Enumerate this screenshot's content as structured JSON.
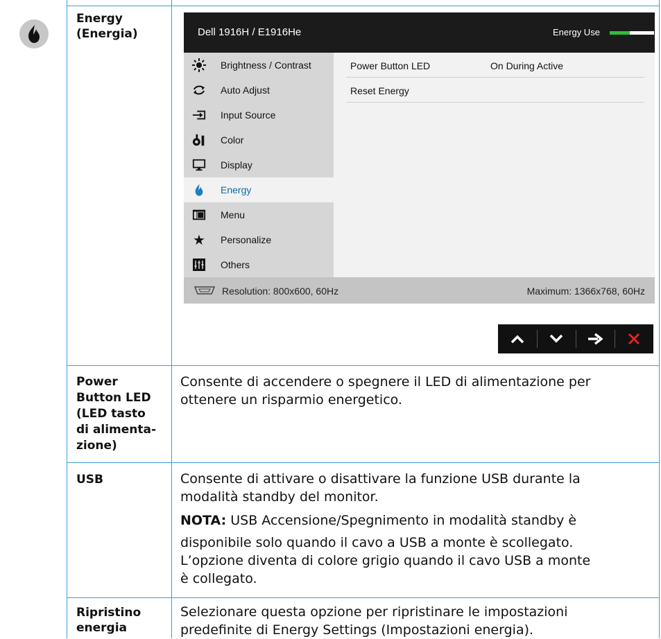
{
  "feature": {
    "title": "Energy (Energia)",
    "title_line1": "Energy",
    "title_line2": "(Energia)",
    "icon": "flame-icon"
  },
  "osd": {
    "model": "Dell 1916H / E1916He",
    "energy_use_label": "Energy Use",
    "energy_use_level_percent": 45,
    "menu": [
      {
        "label": "Brightness / Contrast",
        "icon": "brightness-icon"
      },
      {
        "label": "Auto Adjust",
        "icon": "auto-adjust-icon"
      },
      {
        "label": "Input Source",
        "icon": "input-source-icon"
      },
      {
        "label": "Color",
        "icon": "color-icon"
      },
      {
        "label": "Display",
        "icon": "display-icon"
      },
      {
        "label": "Energy",
        "icon": "flame-icon",
        "active": true
      },
      {
        "label": "Menu",
        "icon": "menu-icon"
      },
      {
        "label": "Personalize",
        "icon": "star-icon"
      },
      {
        "label": "Others",
        "icon": "others-icon"
      }
    ],
    "submenu": [
      {
        "label": "Power Button LED",
        "value": "On During Active"
      },
      {
        "label": "Reset Energy",
        "value": ""
      }
    ],
    "resolution": "Resolution: 800x600, 60Hz",
    "maximum": "Maximum: 1366x768, 60Hz",
    "nav_buttons": [
      "up-arrow-icon",
      "down-arrow-icon",
      "right-arrow-icon",
      "close-icon"
    ]
  },
  "rows": [
    {
      "label_lines": [
        "Power",
        "Button LED",
        "(LED tasto",
        "di alimenta-",
        "zione)"
      ],
      "desc_lines": [
        "Consente di accendere o spegnere il LED di alimentazione per",
        "ottenere un risparmio energetico."
      ]
    },
    {
      "label_lines": [
        "USB"
      ],
      "desc_lines": [
        "Consente di attivare o disattivare la funzione USB durante la",
        "modalità standby del monitor."
      ],
      "note_label": "NOTA:",
      "note_lines": [
        " USB Accensione/Spegnimento in modalità standby è",
        "disponibile solo quando il cavo a USB a monte è scollegato.",
        "L’opzione diventa di colore grigio quando il cavo USB a monte",
        "è collegato."
      ]
    },
    {
      "label_lines": [
        "Ripristino",
        "energia"
      ],
      "desc_lines": [
        "Selezionare questa opzione per ripristinare le impostazioni",
        "predefinite di Energy Settings (Impostazioni energia)."
      ]
    }
  ]
}
